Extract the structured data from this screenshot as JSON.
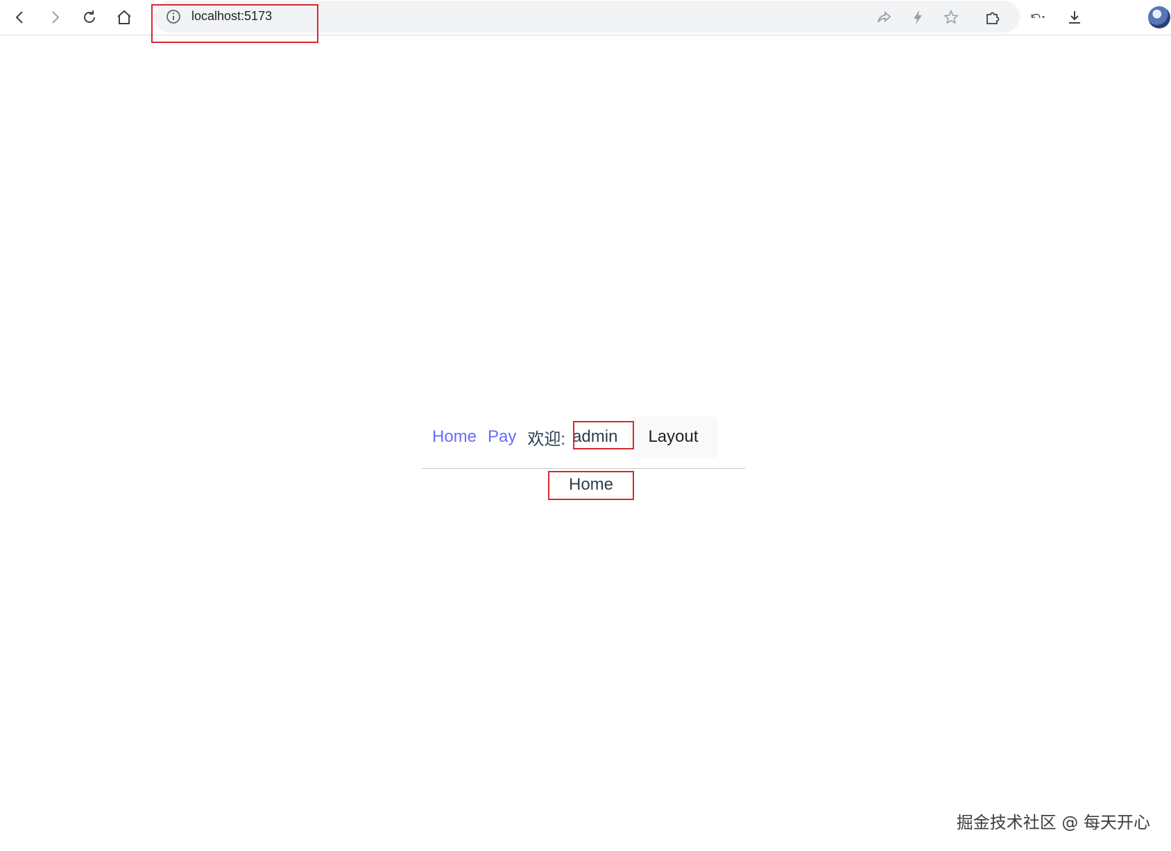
{
  "browser": {
    "url": "localhost:5173",
    "icons": {
      "back": "arrow-left-icon",
      "forward": "arrow-right-icon",
      "reload": "reload-icon",
      "home": "home-icon",
      "site_info": "info-icon",
      "share": "share-icon",
      "flash": "lightning-icon",
      "bookmark": "star-icon",
      "extensions": "puzzle-icon",
      "undo": "undo-icon",
      "download": "download-icon",
      "profile": "avatar"
    }
  },
  "nav": {
    "links": [
      {
        "label": "Home"
      },
      {
        "label": "Pay"
      }
    ],
    "welcome_label": "欢迎:",
    "username": "admin",
    "layout_button": "Layout"
  },
  "route_view": {
    "text": "Home"
  },
  "watermark": "掘金技术社区 @ 每天开心",
  "colors": {
    "link": "#646cff",
    "text": "#2c3e50",
    "highlight": "#d9262f"
  }
}
